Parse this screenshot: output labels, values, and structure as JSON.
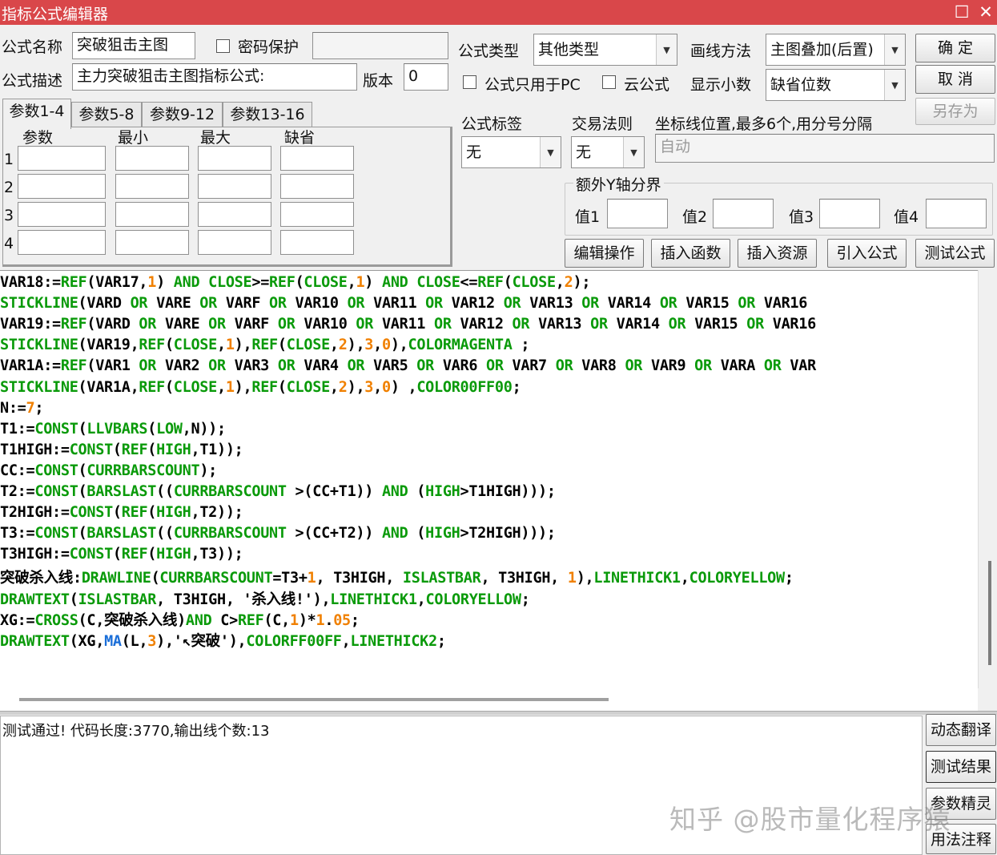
{
  "window": {
    "title": "指标公式编辑器",
    "maximize_glyph": "☐",
    "close_glyph": "✕"
  },
  "form": {
    "name_label": "公式名称",
    "name_value": "突破狙击主图",
    "password_label": "密码保护",
    "password_value": "",
    "desc_label": "公式描述",
    "desc_value": "主力突破狙击主图指标公式:",
    "version_label": "版本",
    "version_value": "0",
    "type_label": "公式类型",
    "type_value": "其他类型",
    "draw_label": "画线方法",
    "draw_value": "主图叠加(后置)",
    "pc_only_label": "公式只用于PC",
    "cloud_label": "云公式",
    "decimal_label": "显示小数",
    "decimal_value": "缺省位数",
    "tag_label": "公式标签",
    "tag_value": "无",
    "trade_label": "交易法则",
    "trade_value": "无",
    "coordline_label": "坐标线位置,最多6个,用分号分隔",
    "coordline_placeholder": "自动",
    "yaxis_label": "额外Y轴分界",
    "y_values": [
      "值1",
      "值2",
      "值3",
      "值4"
    ]
  },
  "buttons": {
    "ok": "确  定",
    "cancel": "取  消",
    "save_as": "另存为",
    "edit_ops": "编辑操作",
    "insert_func": "插入函数",
    "insert_res": "插入资源",
    "import_formula": "引入公式",
    "test_formula": "测试公式",
    "dyn_translate": "动态翻译",
    "test_result": "测试结果",
    "param_wizard": "参数精灵",
    "usage_notes": "用法注释"
  },
  "tabs": [
    "参数1-4",
    "参数5-8",
    "参数9-12",
    "参数13-16"
  ],
  "param_headers": [
    "参数",
    "最小",
    "最大",
    "缺省"
  ],
  "param_rows": [
    "1",
    "2",
    "3",
    "4"
  ],
  "colors": {
    "plain": "#000000",
    "func": "#0a9a0a",
    "keyword": "#0a9a0a",
    "number": "#f08000",
    "special": "#1a6ed8",
    "titlebar": "#d9474a"
  },
  "code_lines": [
    [
      [
        "plain",
        "VAR18:="
      ],
      [
        "func",
        "REF"
      ],
      [
        "plain",
        "(VAR17,"
      ],
      [
        "number",
        "1"
      ],
      [
        "plain",
        ") "
      ],
      [
        "keyword",
        "AND"
      ],
      [
        "plain",
        " "
      ],
      [
        "func",
        "CLOSE"
      ],
      [
        "plain",
        ">="
      ],
      [
        "func",
        "REF"
      ],
      [
        "plain",
        "("
      ],
      [
        "func",
        "CLOSE"
      ],
      [
        "plain",
        ","
      ],
      [
        "number",
        "1"
      ],
      [
        "plain",
        ") "
      ],
      [
        "keyword",
        "AND"
      ],
      [
        "plain",
        " "
      ],
      [
        "func",
        "CLOSE"
      ],
      [
        "plain",
        "<="
      ],
      [
        "func",
        "REF"
      ],
      [
        "plain",
        "("
      ],
      [
        "func",
        "CLOSE"
      ],
      [
        "plain",
        ","
      ],
      [
        "number",
        "2"
      ],
      [
        "plain",
        ");"
      ]
    ],
    [
      [
        "func",
        "STICKLINE"
      ],
      [
        "plain",
        "(VARD "
      ],
      [
        "keyword",
        "OR"
      ],
      [
        "plain",
        " VARE "
      ],
      [
        "keyword",
        "OR"
      ],
      [
        "plain",
        " VARF "
      ],
      [
        "keyword",
        "OR"
      ],
      [
        "plain",
        " VAR10 "
      ],
      [
        "keyword",
        "OR"
      ],
      [
        "plain",
        " VAR11 "
      ],
      [
        "keyword",
        "OR"
      ],
      [
        "plain",
        " VAR12 "
      ],
      [
        "keyword",
        "OR"
      ],
      [
        "plain",
        " VAR13 "
      ],
      [
        "keyword",
        "OR"
      ],
      [
        "plain",
        " VAR14 "
      ],
      [
        "keyword",
        "OR"
      ],
      [
        "plain",
        " VAR15 "
      ],
      [
        "keyword",
        "OR"
      ],
      [
        "plain",
        " VAR16"
      ]
    ],
    [
      [
        "plain",
        "VAR19:="
      ],
      [
        "func",
        "REF"
      ],
      [
        "plain",
        "(VARD "
      ],
      [
        "keyword",
        "OR"
      ],
      [
        "plain",
        " VARE "
      ],
      [
        "keyword",
        "OR"
      ],
      [
        "plain",
        " VARF "
      ],
      [
        "keyword",
        "OR"
      ],
      [
        "plain",
        " VAR10 "
      ],
      [
        "keyword",
        "OR"
      ],
      [
        "plain",
        " VAR11 "
      ],
      [
        "keyword",
        "OR"
      ],
      [
        "plain",
        " VAR12 "
      ],
      [
        "keyword",
        "OR"
      ],
      [
        "plain",
        " VAR13 "
      ],
      [
        "keyword",
        "OR"
      ],
      [
        "plain",
        " VAR14 "
      ],
      [
        "keyword",
        "OR"
      ],
      [
        "plain",
        " VAR15 "
      ],
      [
        "keyword",
        "OR"
      ],
      [
        "plain",
        " VAR16"
      ]
    ],
    [
      [
        "func",
        "STICKLINE"
      ],
      [
        "plain",
        "(VAR19,"
      ],
      [
        "func",
        "REF"
      ],
      [
        "plain",
        "("
      ],
      [
        "func",
        "CLOSE"
      ],
      [
        "plain",
        ","
      ],
      [
        "number",
        "1"
      ],
      [
        "plain",
        "),"
      ],
      [
        "func",
        "REF"
      ],
      [
        "plain",
        "("
      ],
      [
        "func",
        "CLOSE"
      ],
      [
        "plain",
        ","
      ],
      [
        "number",
        "2"
      ],
      [
        "plain",
        "),"
      ],
      [
        "number",
        "3"
      ],
      [
        "plain",
        ","
      ],
      [
        "number",
        "0"
      ],
      [
        "plain",
        "),"
      ],
      [
        "func",
        "COLORMAGENTA"
      ],
      [
        "plain",
        " ;"
      ]
    ],
    [
      [
        "plain",
        "VAR1A:="
      ],
      [
        "func",
        "REF"
      ],
      [
        "plain",
        "(VAR1 "
      ],
      [
        "keyword",
        "OR"
      ],
      [
        "plain",
        " VAR2 "
      ],
      [
        "keyword",
        "OR"
      ],
      [
        "plain",
        " VAR3 "
      ],
      [
        "keyword",
        "OR"
      ],
      [
        "plain",
        " VAR4 "
      ],
      [
        "keyword",
        "OR"
      ],
      [
        "plain",
        " VAR5 "
      ],
      [
        "keyword",
        "OR"
      ],
      [
        "plain",
        " VAR6 "
      ],
      [
        "keyword",
        "OR"
      ],
      [
        "plain",
        " VAR7 "
      ],
      [
        "keyword",
        "OR"
      ],
      [
        "plain",
        " VAR8 "
      ],
      [
        "keyword",
        "OR"
      ],
      [
        "plain",
        " VAR9 "
      ],
      [
        "keyword",
        "OR"
      ],
      [
        "plain",
        " VARA "
      ],
      [
        "keyword",
        "OR"
      ],
      [
        "plain",
        " VAR"
      ]
    ],
    [
      [
        "func",
        "STICKLINE"
      ],
      [
        "plain",
        "(VAR1A,"
      ],
      [
        "func",
        "REF"
      ],
      [
        "plain",
        "("
      ],
      [
        "func",
        "CLOSE"
      ],
      [
        "plain",
        ","
      ],
      [
        "number",
        "1"
      ],
      [
        "plain",
        "),"
      ],
      [
        "func",
        "REF"
      ],
      [
        "plain",
        "("
      ],
      [
        "func",
        "CLOSE"
      ],
      [
        "plain",
        ","
      ],
      [
        "number",
        "2"
      ],
      [
        "plain",
        "),"
      ],
      [
        "number",
        "3"
      ],
      [
        "plain",
        ","
      ],
      [
        "number",
        "0"
      ],
      [
        "plain",
        ") ,"
      ],
      [
        "func",
        "COLOR00FF00"
      ],
      [
        "plain",
        ";"
      ]
    ],
    [
      [
        "plain",
        "N:="
      ],
      [
        "number",
        "7"
      ],
      [
        "plain",
        ";"
      ]
    ],
    [
      [
        "plain",
        "T1:="
      ],
      [
        "func",
        "CONST"
      ],
      [
        "plain",
        "("
      ],
      [
        "func",
        "LLVBARS"
      ],
      [
        "plain",
        "("
      ],
      [
        "func",
        "LOW"
      ],
      [
        "plain",
        ",N));"
      ]
    ],
    [
      [
        "plain",
        "T1HIGH:="
      ],
      [
        "func",
        "CONST"
      ],
      [
        "plain",
        "("
      ],
      [
        "func",
        "REF"
      ],
      [
        "plain",
        "("
      ],
      [
        "func",
        "HIGH"
      ],
      [
        "plain",
        ",T1));"
      ]
    ],
    [
      [
        "plain",
        "CC:="
      ],
      [
        "func",
        "CONST"
      ],
      [
        "plain",
        "("
      ],
      [
        "func",
        "CURRBARSCOUNT"
      ],
      [
        "plain",
        ");"
      ]
    ],
    [
      [
        "plain",
        "T2:="
      ],
      [
        "func",
        "CONST"
      ],
      [
        "plain",
        "("
      ],
      [
        "func",
        "BARSLAST"
      ],
      [
        "plain",
        "(("
      ],
      [
        "func",
        "CURRBARSCOUNT"
      ],
      [
        "plain",
        " >(CC+T1)) "
      ],
      [
        "keyword",
        "AND"
      ],
      [
        "plain",
        " ("
      ],
      [
        "func",
        "HIGH"
      ],
      [
        "plain",
        ">T1HIGH)));"
      ]
    ],
    [
      [
        "plain",
        "T2HIGH:="
      ],
      [
        "func",
        "CONST"
      ],
      [
        "plain",
        "("
      ],
      [
        "func",
        "REF"
      ],
      [
        "plain",
        "("
      ],
      [
        "func",
        "HIGH"
      ],
      [
        "plain",
        ",T2));"
      ]
    ],
    [
      [
        "plain",
        "T3:="
      ],
      [
        "func",
        "CONST"
      ],
      [
        "plain",
        "("
      ],
      [
        "func",
        "BARSLAST"
      ],
      [
        "plain",
        "(("
      ],
      [
        "func",
        "CURRBARSCOUNT"
      ],
      [
        "plain",
        " >(CC+T2)) "
      ],
      [
        "keyword",
        "AND"
      ],
      [
        "plain",
        " ("
      ],
      [
        "func",
        "HIGH"
      ],
      [
        "plain",
        ">T2HIGH)));"
      ]
    ],
    [
      [
        "plain",
        "T3HIGH:="
      ],
      [
        "func",
        "CONST"
      ],
      [
        "plain",
        "("
      ],
      [
        "func",
        "REF"
      ],
      [
        "plain",
        "("
      ],
      [
        "func",
        "HIGH"
      ],
      [
        "plain",
        ",T3));"
      ]
    ],
    [
      [
        "plain",
        "突破杀入线:"
      ],
      [
        "func",
        "DRAWLINE"
      ],
      [
        "plain",
        "("
      ],
      [
        "func",
        "CURRBARSCOUNT"
      ],
      [
        "plain",
        "=T3+"
      ],
      [
        "number",
        "1"
      ],
      [
        "plain",
        ", T3HIGH, "
      ],
      [
        "func",
        "ISLASTBAR"
      ],
      [
        "plain",
        ", T3HIGH, "
      ],
      [
        "number",
        "1"
      ],
      [
        "plain",
        "),"
      ],
      [
        "func",
        "LINETHICK1"
      ],
      [
        "plain",
        ","
      ],
      [
        "func",
        "COLORYELLOW"
      ],
      [
        "plain",
        ";"
      ]
    ],
    [
      [
        "func",
        "DRAWTEXT"
      ],
      [
        "plain",
        "("
      ],
      [
        "func",
        "ISLASTBAR"
      ],
      [
        "plain",
        ", T3HIGH, '杀入线!'),"
      ],
      [
        "func",
        "LINETHICK1"
      ],
      [
        "plain",
        ","
      ],
      [
        "func",
        "COLORYELLOW"
      ],
      [
        "plain",
        ";"
      ]
    ],
    [
      [
        "plain",
        "XG:="
      ],
      [
        "func",
        "CROSS"
      ],
      [
        "plain",
        "(C,突破杀入线)"
      ],
      [
        "keyword",
        "AND"
      ],
      [
        "plain",
        " C>"
      ],
      [
        "func",
        "REF"
      ],
      [
        "plain",
        "(C,"
      ],
      [
        "number",
        "1"
      ],
      [
        "plain",
        ")*"
      ],
      [
        "number",
        "1"
      ],
      [
        "plain",
        "."
      ],
      [
        "number",
        "05"
      ],
      [
        "plain",
        ";"
      ]
    ],
    [
      [
        "func",
        "DRAWTEXT"
      ],
      [
        "plain",
        "(XG,"
      ],
      [
        "special",
        "MA"
      ],
      [
        "plain",
        "(L,"
      ],
      [
        "number",
        "3"
      ],
      [
        "plain",
        "),'↖突破'),"
      ],
      [
        "func",
        "COLORFF00FF"
      ],
      [
        "plain",
        ","
      ],
      [
        "func",
        "LINETHICK2"
      ],
      [
        "plain",
        ";"
      ]
    ]
  ],
  "output": {
    "message": "测试通过! 代码长度:3770,输出线个数:13"
  },
  "watermark": "知乎 @股市量化程序猿"
}
